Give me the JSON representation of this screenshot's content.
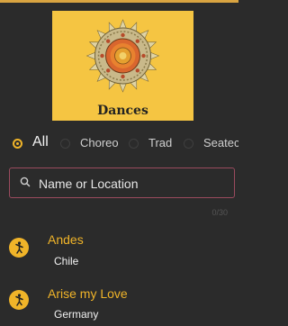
{
  "logo": {
    "title": "Dances",
    "icon": "mandala-icon",
    "colors": {
      "card": "#f5c542",
      "accent": "#f0b429"
    }
  },
  "filters": [
    {
      "label": "All",
      "selected": true
    },
    {
      "label": "Choreo",
      "selected": false
    },
    {
      "label": "Trad",
      "selected": false
    },
    {
      "label": "Seatec",
      "selected": false
    }
  ],
  "search": {
    "placeholder": "Name or Location",
    "counter": "0/30"
  },
  "dances": [
    {
      "title": "Andes",
      "location": "Chile"
    },
    {
      "title": "Arise my Love",
      "location": "Germany"
    }
  ]
}
